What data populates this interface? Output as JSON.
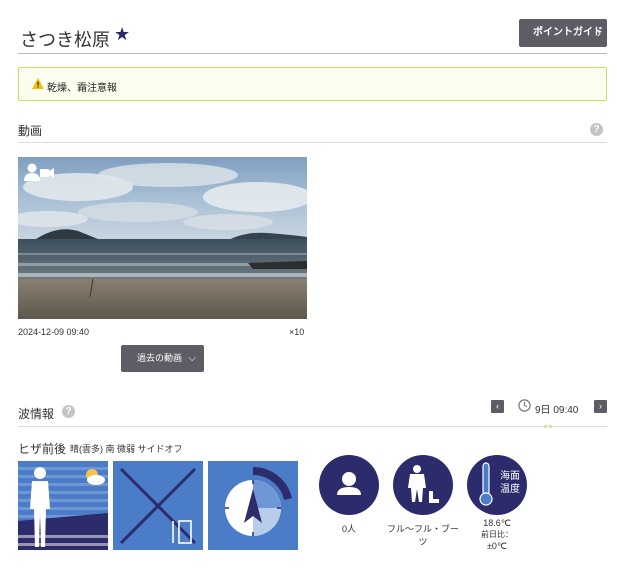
{
  "header": {
    "title": "さつき松原",
    "star_icon": "star-icon",
    "guide_button_label": "ポイントガイド",
    "guide_button_chevron": "›"
  },
  "alert": {
    "icon": "warning-icon",
    "text": "乾燥、霜注意報"
  },
  "video_section": {
    "title": "動画",
    "help_icon": "?",
    "timestamp": "2024-12-09 09:40",
    "speed": "×10",
    "past_button_label": "過去の動画",
    "past_button_chevron": "⌵"
  },
  "wave_section": {
    "title": "波情報",
    "help_icon": "?",
    "prev_arrow": "‹",
    "next_arrow": "›",
    "time": "9日 09:40",
    "size": "ヒザ前後",
    "conditions": "晴(雲多) 南 微弱 サイドオフ"
  },
  "info_circles": [
    {
      "icon": "person-icon",
      "label": "0人"
    },
    {
      "icon": "wetsuit-icon",
      "label": "フル〜フル・ブーツ"
    },
    {
      "icon": "thermometer-icon",
      "icon_text": "海面\n温度",
      "label": "18.6℃",
      "sub1": "前日比：",
      "sub2": "±0℃"
    }
  ],
  "colors": {
    "button_bg": "#5d5d66",
    "navy": "#2c2b6b",
    "tile_blue": "#4a7cc8",
    "alert_border": "#c9de6a",
    "dot_active": "#c9de6a"
  }
}
